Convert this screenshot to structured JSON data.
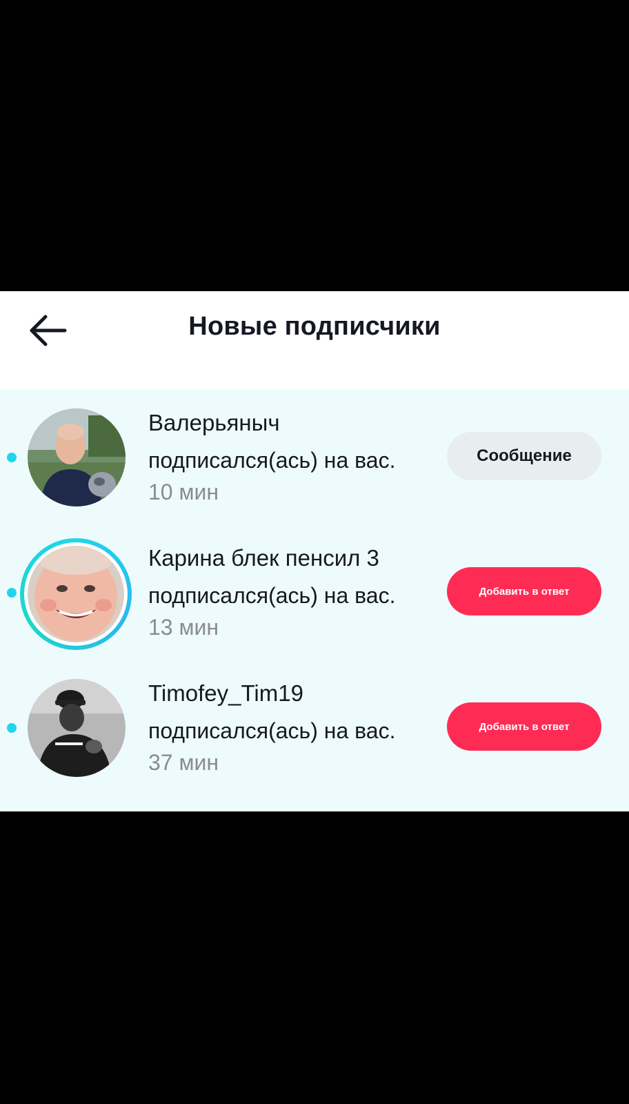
{
  "header": {
    "title": "Новые подписчики"
  },
  "followers": [
    {
      "name": "Валерьяныч",
      "action_text": "подписался(ась) на вас.",
      "time": "10 мин",
      "button_label": "Сообщение",
      "unread": true,
      "has_story": false
    },
    {
      "name": "Карина блек пенсил 3",
      "action_text": "подписался(ась) на вас.",
      "time": "13 мин",
      "button_label": "Добавить в ответ",
      "unread": true,
      "has_story": true
    },
    {
      "name": "Timofey_Tim19",
      "action_text": "подписался(ась) на вас.",
      "time": "37 мин",
      "button_label": "Добавить в ответ",
      "unread": true,
      "has_story": false
    }
  ],
  "colors": {
    "accent_red": "#fe2c55",
    "unread_dot": "#20d5ec",
    "list_background": "#eefbfd",
    "secondary_text": "#8a8b91"
  },
  "icons": {
    "back": "arrow-left-icon"
  }
}
